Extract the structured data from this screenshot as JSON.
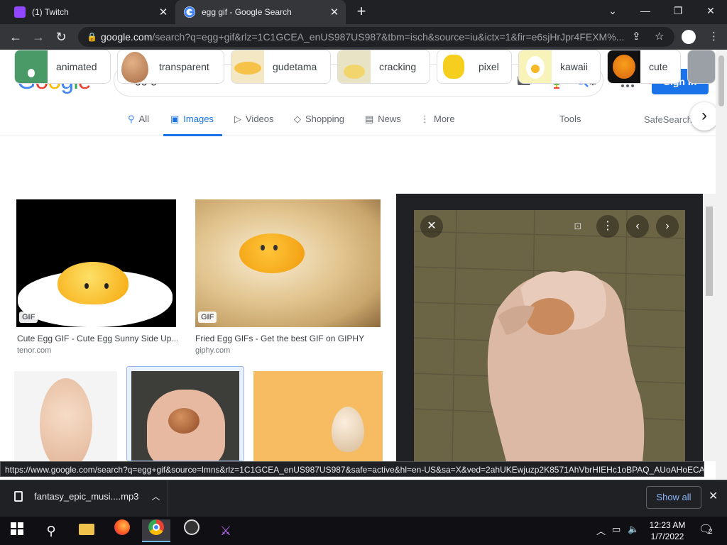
{
  "browser": {
    "tabs": [
      {
        "title": "(1) Twitch",
        "favicon": "twitch-icon",
        "color": "#9146ff"
      },
      {
        "title": "egg gif - Google Search",
        "favicon": "google-icon",
        "active": true
      }
    ],
    "new_tab": "+",
    "window_controls": {
      "minimize": "—",
      "restore": "❐",
      "close": "✕",
      "tab_search": "⌄"
    },
    "url_host": "google.com",
    "url_rest": "/search?q=egg+gif&rlz=1C1GCEA_enUS987US987&tbm=isch&source=iu&ictx=1&fir=e6sjHrJpr4FEXM%..."
  },
  "google": {
    "logo": "Google",
    "query": "egg gif",
    "sign_in": "Sign in",
    "tabs": [
      {
        "label": "All",
        "icon": "search-icon"
      },
      {
        "label": "Images",
        "icon": "image-icon",
        "active": true
      },
      {
        "label": "Videos",
        "icon": "play-icon"
      },
      {
        "label": "Shopping",
        "icon": "tag-icon"
      },
      {
        "label": "News",
        "icon": "news-icon"
      },
      {
        "label": "More",
        "icon": "more-vert-icon"
      }
    ],
    "tools": "Tools",
    "safesearch": "SafeSearch on ▾",
    "chips": [
      "animated",
      "transparent",
      "gudetama",
      "cracking",
      "pixel",
      "kawaii",
      "cute"
    ],
    "results": [
      {
        "caption": "Cute Egg GIF - Cute Egg Sunny Side Up...",
        "source": "tenor.com",
        "badge": "GIF"
      },
      {
        "caption": "Fried Egg GIFs - Get the best GIF on GIPHY",
        "source": "giphy.com",
        "badge": "GIF"
      }
    ]
  },
  "status_url": "https://www.google.com/search?q=egg+gif&source=lmns&rlz=1C1GCEA_enUS987US987&safe=active&hl=en-US&sa=X&ved=2ahUKEwjuzp2K8571AhVbrHIEHc1oBPAQ_AUoAHoECA...",
  "download": {
    "filename": "fantasy_epic_musi....mp3",
    "show_all": "Show all"
  },
  "taskbar": {
    "time": "12:23 AM",
    "date": "1/7/2022",
    "notifications": "2"
  },
  "colors": {
    "accent": "#1a73e8",
    "chrome_dark": "#202124"
  }
}
